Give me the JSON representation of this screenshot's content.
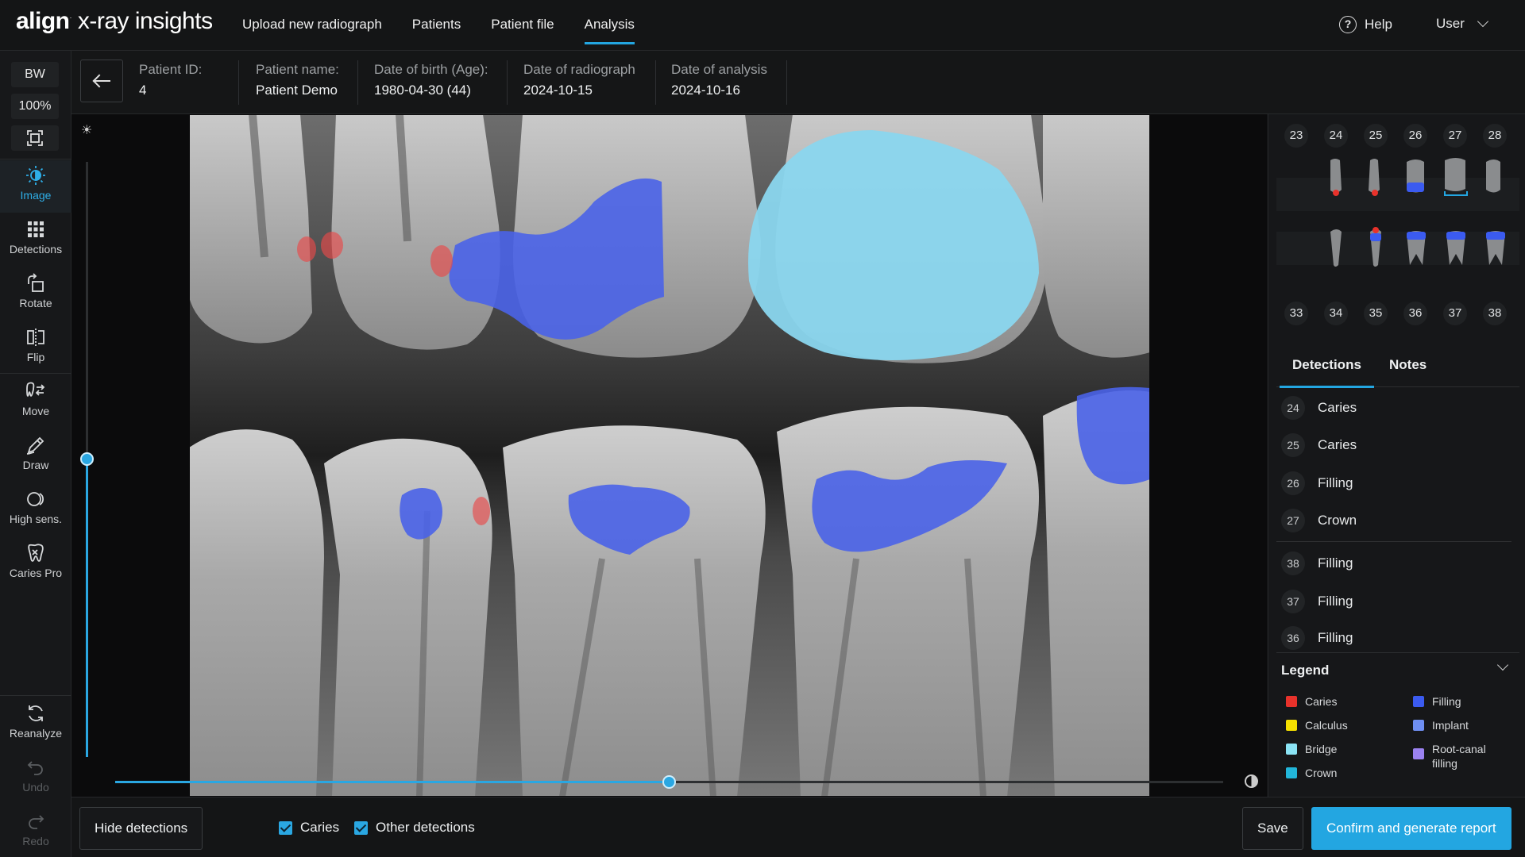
{
  "app": {
    "logo_brand": "align",
    "logo_product": "x-ray insights"
  },
  "nav": {
    "items": [
      {
        "label": "Upload new radiograph"
      },
      {
        "label": "Patients"
      },
      {
        "label": "Patient file"
      },
      {
        "label": "Analysis",
        "active": true
      }
    ],
    "help_label": "Help",
    "user_label": "User"
  },
  "toolbar": {
    "mode_chip": "BW",
    "zoom_chip": "100%",
    "tools": [
      {
        "label": "Image",
        "icon": "brightness-icon",
        "active": true
      },
      {
        "label": "Detections",
        "icon": "grid-icon"
      },
      {
        "label": "Rotate",
        "icon": "rotate-icon"
      },
      {
        "label": "Flip",
        "icon": "flip-icon"
      },
      {
        "label": "Move",
        "icon": "move-icon"
      },
      {
        "label": "Draw",
        "icon": "pencil-icon"
      },
      {
        "label": "High sens.",
        "icon": "high-sensitivity-icon"
      },
      {
        "label": "Caries Pro",
        "icon": "caries-pro-icon"
      }
    ],
    "reanalyze_label": "Reanalyze",
    "undo_label": "Undo",
    "redo_label": "Redo"
  },
  "patient": {
    "id_key": "Patient ID:",
    "id_value": "4",
    "name_key": "Patient name:",
    "name_value": "Patient Demo",
    "dob_key": "Date of birth (Age):",
    "dob_value": "1980-04-30 (44)",
    "radiograph_key": "Date of radiograph",
    "radiograph_value": "2024-10-15",
    "analysis_key": "Date of analysis",
    "analysis_value": "2024-10-16"
  },
  "viewer": {
    "brightness_level": 0.45,
    "contrast_level": 0.5
  },
  "tooth_chart": {
    "upper_numbers": [
      "23",
      "24",
      "25",
      "26",
      "27",
      "28"
    ],
    "lower_numbers": [
      "33",
      "34",
      "35",
      "36",
      "37",
      "38"
    ]
  },
  "panel_tabs": {
    "detections": "Detections",
    "notes": "Notes"
  },
  "detections": [
    {
      "tooth": "24",
      "label": "Caries"
    },
    {
      "tooth": "25",
      "label": "Caries"
    },
    {
      "tooth": "26",
      "label": "Filling"
    },
    {
      "tooth": "27",
      "label": "Crown"
    },
    {
      "tooth": "38",
      "label": "Filling"
    },
    {
      "tooth": "37",
      "label": "Filling"
    },
    {
      "tooth": "36",
      "label": "Filling"
    }
  ],
  "legend": {
    "title": "Legend",
    "items": [
      {
        "label": "Caries",
        "color": "#e8322b"
      },
      {
        "label": "Filling",
        "color": "#3b5bf0"
      },
      {
        "label": "Calculus",
        "color": "#f5e000"
      },
      {
        "label": "Implant",
        "color": "#6f8ff2"
      },
      {
        "label": "Bridge",
        "color": "#8be4f5"
      },
      {
        "label": "Root-canal filling",
        "color": "#9b82f0"
      },
      {
        "label": "Crown",
        "color": "#22b6da"
      }
    ]
  },
  "bottom": {
    "hide_detections": "Hide detections",
    "caries_check": "Caries",
    "other_check": "Other detections",
    "save": "Save",
    "confirm": "Confirm and generate report"
  },
  "colors": {
    "accent": "#23a6e1",
    "caries": "#e8322b",
    "filling": "#4a63e8",
    "crown": "#8ad6ee"
  }
}
